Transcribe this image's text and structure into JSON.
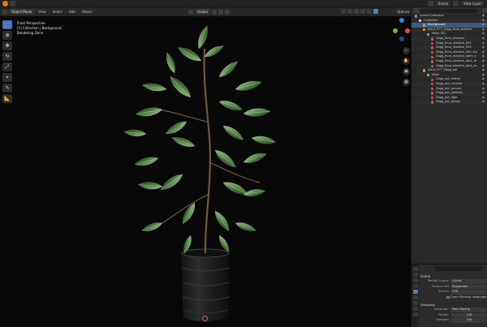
{
  "topbar": {
    "scene_value": "Scene",
    "view_layer_value": "View Layer"
  },
  "viewport_header": {
    "mode": "Object Mode",
    "menus": [
      "View",
      "Select",
      "Add",
      "Object"
    ],
    "transform_orientation": "Global",
    "options": "Options"
  },
  "overlay": {
    "line1": "Front Perspective",
    "line2": "(1) Collection | Background",
    "line3": "Rendering Done"
  },
  "outliner": {
    "rows": [
      {
        "label": "Scene Collection",
        "indent": 2,
        "icon": "collection-icon",
        "color": "#8b8b8b",
        "sel": false
      },
      {
        "label": "Collection",
        "indent": 7,
        "icon": "collection-icon",
        "color": "#d8d8d8",
        "sel": false
      },
      {
        "label": "Background",
        "indent": 12,
        "icon": "mesh-icon",
        "color": "#e48a3a",
        "sel": true
      },
      {
        "label": "plant_077_Zagg_ficus_elastica",
        "indent": 12,
        "icon": "mesh-icon",
        "color": "#e48a3a",
        "sel": false
      },
      {
        "label": "Mesh.001",
        "indent": 17,
        "icon": "mesh-data-icon",
        "color": "#6fbf6f",
        "sel": false
      },
      {
        "label": "Zagg_ficus_elastica",
        "indent": 22,
        "icon": "material-icon",
        "color": "#d04b4b",
        "sel": false
      },
      {
        "label": "Zagg_ficus_elastica_001",
        "indent": 22,
        "icon": "material-icon",
        "color": "#d04b4b",
        "sel": false
      },
      {
        "label": "Zagg_ficus_elastica_002",
        "indent": 22,
        "icon": "material-icon",
        "color": "#d04b4b",
        "sel": false
      },
      {
        "label": "Zagg_ficus_elastica_leaf_sta",
        "indent": 22,
        "icon": "material-icon",
        "color": "#d04b4b",
        "sel": false
      },
      {
        "label": "Zagg_ficus_elastica_stem_s",
        "indent": 22,
        "icon": "material-icon",
        "color": "#d04b4b",
        "sel": false
      },
      {
        "label": "Zagg_ficus_elastica_dark_le",
        "indent": 22,
        "icon": "material-icon",
        "color": "#d04b4b",
        "sel": false
      },
      {
        "label": "Zagg_ficus_elastica_dark_le",
        "indent": 22,
        "icon": "material-icon",
        "color": "#d04b4b",
        "sel": false
      },
      {
        "label": "plant_077_Zagg_pot",
        "indent": 12,
        "icon": "mesh-icon",
        "color": "#e48a3a",
        "sel": false
      },
      {
        "label": "Mesh",
        "indent": 17,
        "icon": "mesh-data-icon",
        "color": "#6fbf6f",
        "sel": false
      },
      {
        "label": "Zagg_pot_metall",
        "indent": 22,
        "icon": "material-icon",
        "color": "#d04b4b",
        "sel": false
      },
      {
        "label": "Zagg_pot_ceramic",
        "indent": 22,
        "icon": "material-icon",
        "color": "#d04b4b",
        "sel": false
      },
      {
        "label": "Zagg_pot_ground",
        "indent": 22,
        "icon": "material-icon",
        "color": "#d04b4b",
        "sel": false
      },
      {
        "label": "Zagg_pot_pebbles",
        "indent": 22,
        "icon": "material-icon",
        "color": "#d04b4b",
        "sel": false
      },
      {
        "label": "Zagg_pot_light",
        "indent": 22,
        "icon": "material-icon",
        "color": "#d04b4b",
        "sel": false
      },
      {
        "label": "Zagg_pot_glossy",
        "indent": 22,
        "icon": "material-icon",
        "color": "#d04b4b",
        "sel": false
      }
    ]
  },
  "properties": {
    "title": "Scene",
    "render_engine_label": "Render Engine",
    "render_engine_value": "Cycles",
    "feature_set_label": "Feature Set",
    "feature_set_value": "Supported",
    "device_label": "Device",
    "device_value": "CPU",
    "osl_label": "Open Shading Language",
    "sampling_label": "Sampling",
    "integrator_label": "Integrator",
    "integrator_value": "Path Tracing",
    "render_label": "Render",
    "render_value": "128",
    "viewport_label": "Viewport",
    "viewport_value": "100"
  },
  "colors": {
    "accent": "#4772b3",
    "selection": "#3b5a87",
    "gizmo_x": "#e04a4a",
    "gizmo_y": "#6fb33a",
    "gizmo_z": "#3a7fe0"
  },
  "icons": {
    "toolbar": [
      "select-box-icon",
      "cursor-icon",
      "move-icon",
      "rotate-icon",
      "scale-icon",
      "transform-icon",
      "annotate-icon",
      "measure-icon"
    ],
    "nav": [
      "zoom-icon",
      "hand-pan-icon",
      "camera-icon",
      "grid-icon"
    ]
  }
}
